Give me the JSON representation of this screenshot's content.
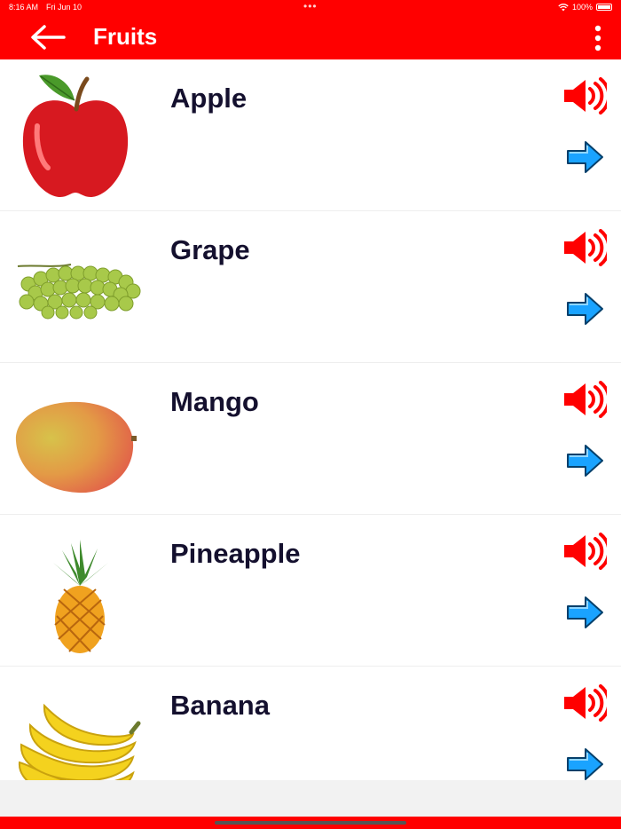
{
  "status": {
    "time": "8:16 AM",
    "date": "Fri Jun 10",
    "battery": "100%",
    "dots": "•••"
  },
  "header": {
    "title": "Fruits",
    "back_icon": "back-arrow-icon",
    "menu_icon": "more-vertical-icon"
  },
  "colors": {
    "brand": "#ff0000",
    "text": "#14102e",
    "speaker": "#ff0000",
    "arrow": "#1aa3ff"
  },
  "fruits": [
    {
      "name": "Apple"
    },
    {
      "name": "Grape"
    },
    {
      "name": "Mango"
    },
    {
      "name": "Pineapple"
    },
    {
      "name": "Banana"
    }
  ]
}
